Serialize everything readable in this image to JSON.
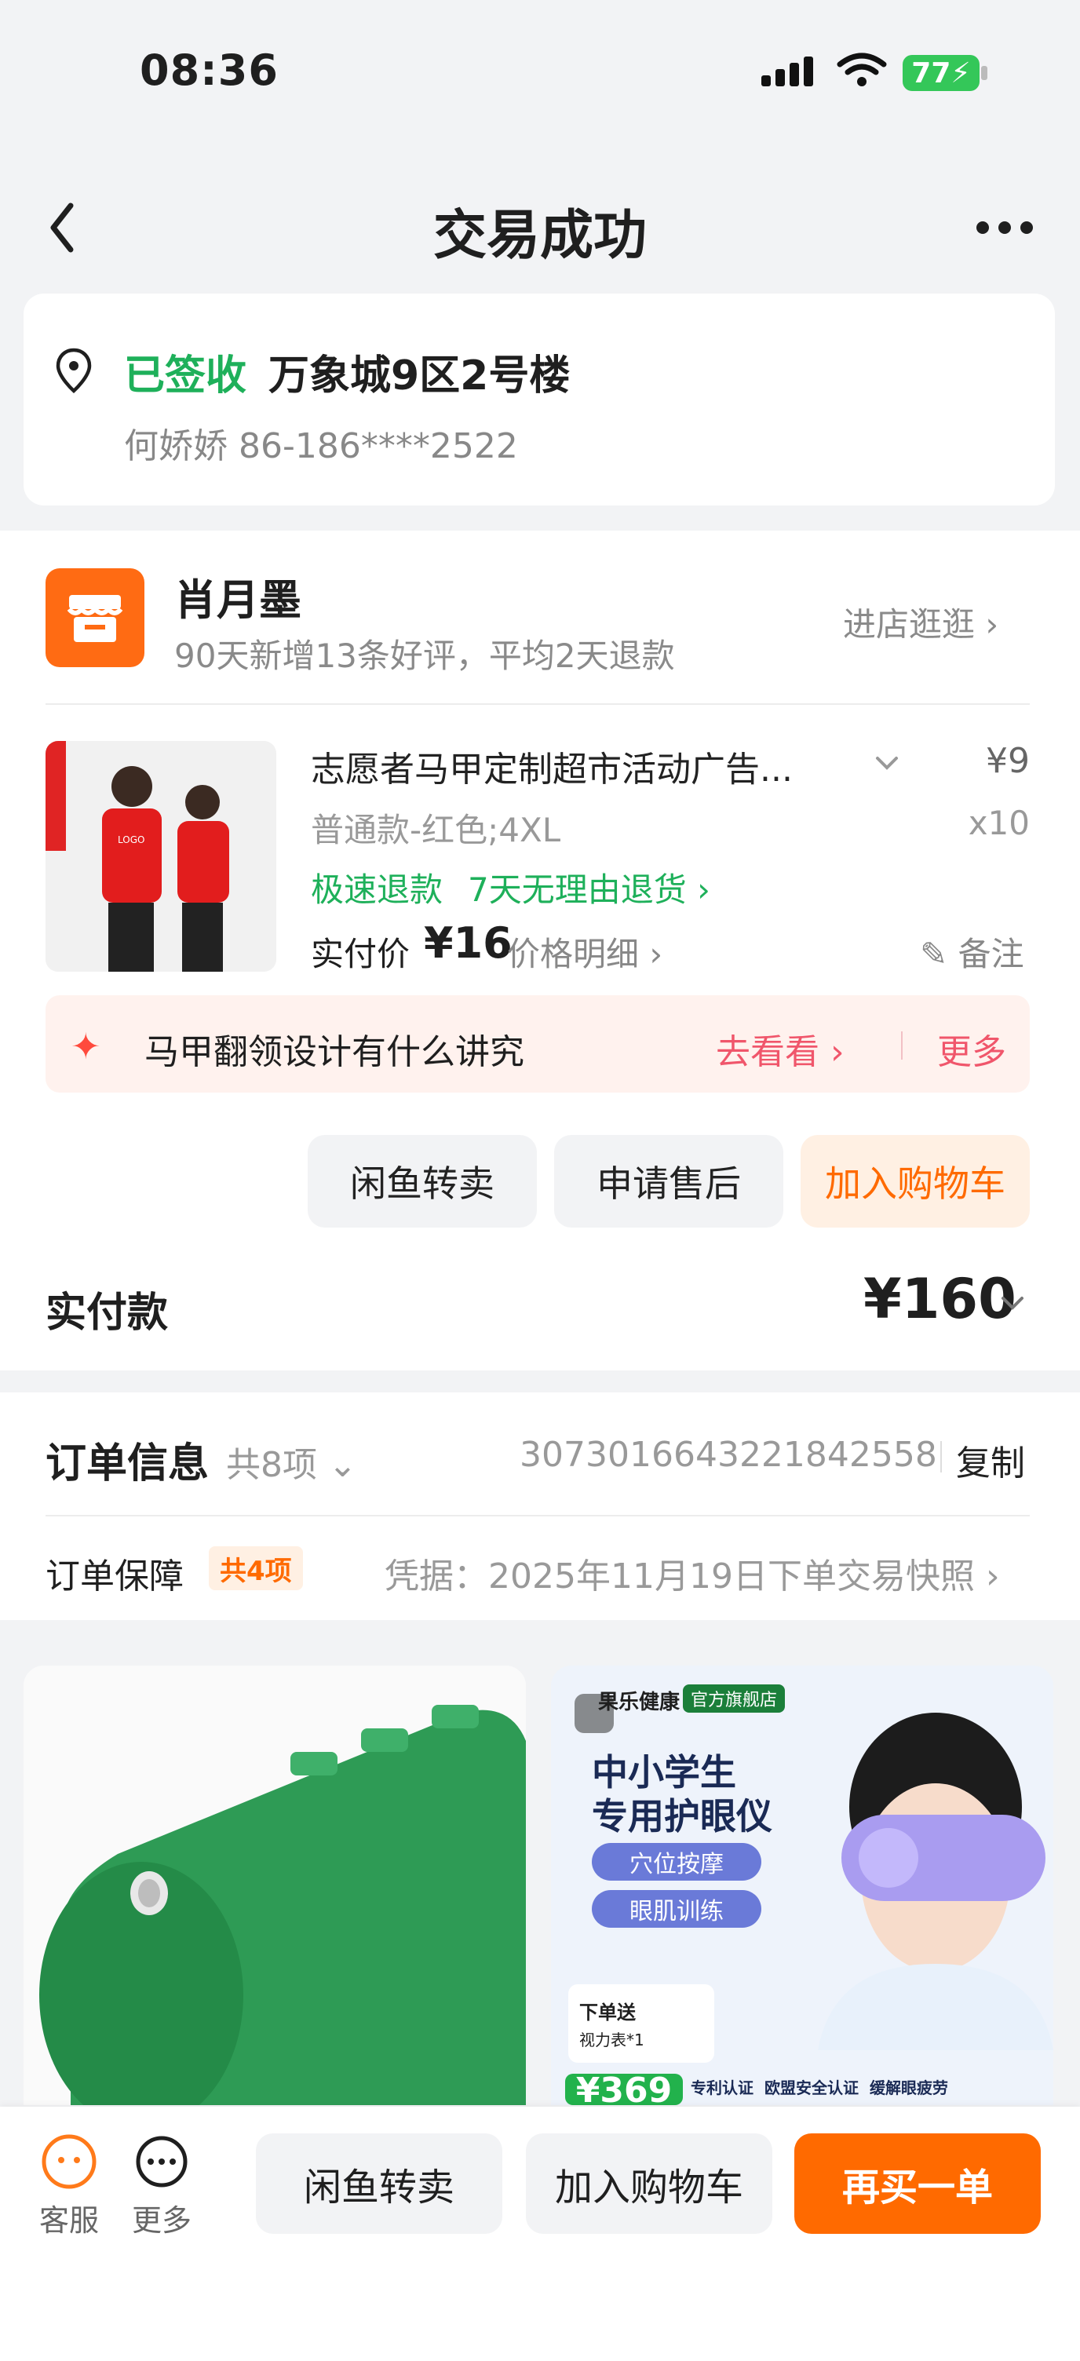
{
  "status_bar": {
    "time": "08:36",
    "battery": "77"
  },
  "nav": {
    "title": "交易成功"
  },
  "address": {
    "status": "已签收",
    "location": "万象城9区2号楼",
    "person": "何娇娇 86-186****2522"
  },
  "store": {
    "name": "肖月墨",
    "desc": "90天新增13条好评，平均2天退款",
    "enter": "进店逛逛"
  },
  "product": {
    "title": "志愿者马甲定制超市活动广告...",
    "price": "¥9",
    "spec": "普通款-红色;4XL",
    "qty": "x10",
    "tags": [
      "极速退款",
      "7天无理由退货"
    ],
    "paid_label": "实付价",
    "paid_value": "¥16",
    "price_detail": "价格明细",
    "note": "备注",
    "image_label": "LOGO"
  },
  "tip": {
    "text": "马甲翻领设计有什么讲究",
    "go": "去看看",
    "more": "更多"
  },
  "actions": {
    "resell": "闲鱼转卖",
    "after_sale": "申请售后",
    "add_cart": "加入购物车"
  },
  "total": {
    "label": "实付款",
    "value": "¥160"
  },
  "order_info": {
    "title": "订单信息",
    "count": "共8项",
    "number": "3073016643221842558",
    "copy": "复制",
    "guarantee_label": "订单保障",
    "guarantee_badge": "共4项",
    "proof": "凭据：2025年11月19日下单交易快照"
  },
  "recommend": {
    "right": {
      "brand": "果乐健康",
      "badge": "官方旗舰店",
      "headline1": "中小学生",
      "headline2": "专用护眼仪",
      "feature1": "穴位按摩",
      "feature2": "眼肌训练",
      "gift_line1": "下单送",
      "gift_line2": "视力表*1",
      "price": "¥369",
      "cert1": "专利认证",
      "cert2": "欧盟安全认证",
      "cert3": "缓解眼疲劳"
    }
  },
  "bottom_bar": {
    "service": "客服",
    "more": "更多",
    "resell": "闲鱼转卖",
    "add_cart": "加入购物车",
    "buy_again": "再买一单"
  },
  "colors": {
    "green": "#1eb05a",
    "orange": "#ff6a00",
    "pink": "#f0566b"
  }
}
